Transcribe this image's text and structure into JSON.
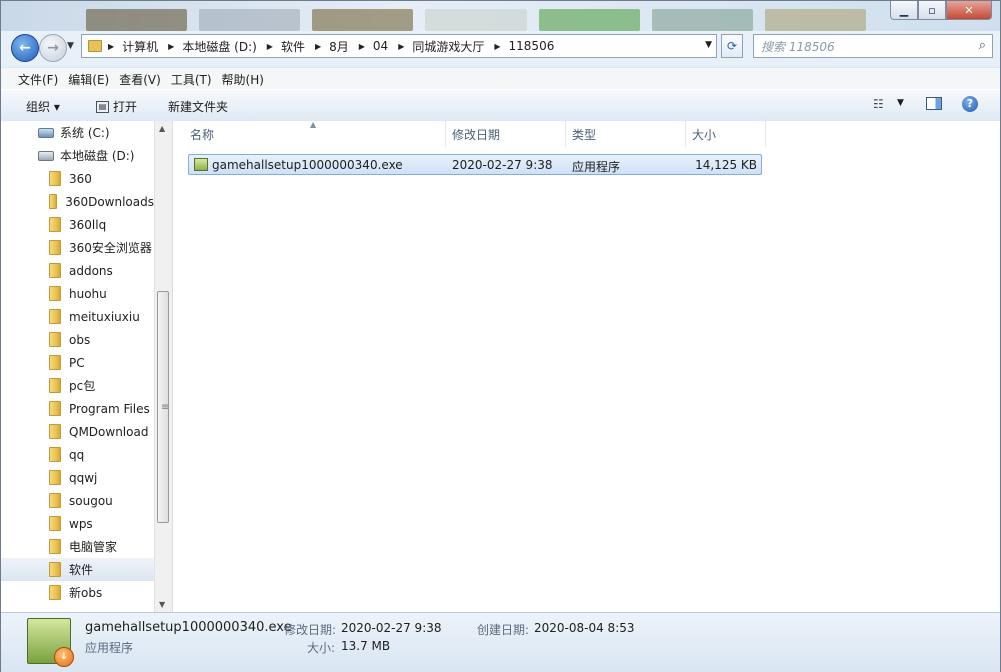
{
  "window": {
    "min_label": "▁",
    "max_label": "▫",
    "close_label": "✕"
  },
  "address": {
    "crumbs": [
      "计算机",
      "本地磁盘 (D:)",
      "软件",
      "8月",
      "04",
      "同城游戏大厅",
      "118506"
    ],
    "sep": "▶"
  },
  "search": {
    "placeholder": "搜索 118506"
  },
  "menu": [
    "文件(F)",
    "编辑(E)",
    "查看(V)",
    "工具(T)",
    "帮助(H)"
  ],
  "toolbar": {
    "organize": "组织 ▾",
    "open": "打开",
    "new_folder": "新建文件夹"
  },
  "nav": {
    "drives": [
      {
        "label": "系统 (C:)"
      },
      {
        "label": "本地磁盘 (D:)"
      }
    ],
    "folders": [
      "360",
      "360Downloads",
      "360llq",
      "360安全浏览器",
      "addons",
      "huohu",
      "meituxiuxiu",
      "obs",
      "PC",
      "pc包",
      "Program Files",
      "QMDownload",
      "qq",
      "qqwj",
      "sougou",
      "wps",
      "电脑管家",
      "软件",
      "新obs"
    ],
    "selected": "软件"
  },
  "columns": {
    "name": "名称",
    "modified": "修改日期",
    "type": "类型",
    "size": "大小"
  },
  "files": [
    {
      "name": "gamehallsetup1000000340.exe",
      "modified": "2020-02-27 9:38",
      "type": "应用程序",
      "size": "14,125 KB"
    }
  ],
  "details": {
    "filename": "gamehallsetup1000000340.exe",
    "filetype": "应用程序",
    "modified_label": "修改日期:",
    "modified_value": "2020-02-27 9:38",
    "created_label": "创建日期:",
    "created_value": "2020-08-04 8:53",
    "size_label": "大小:",
    "size_value": "13.7 MB"
  }
}
